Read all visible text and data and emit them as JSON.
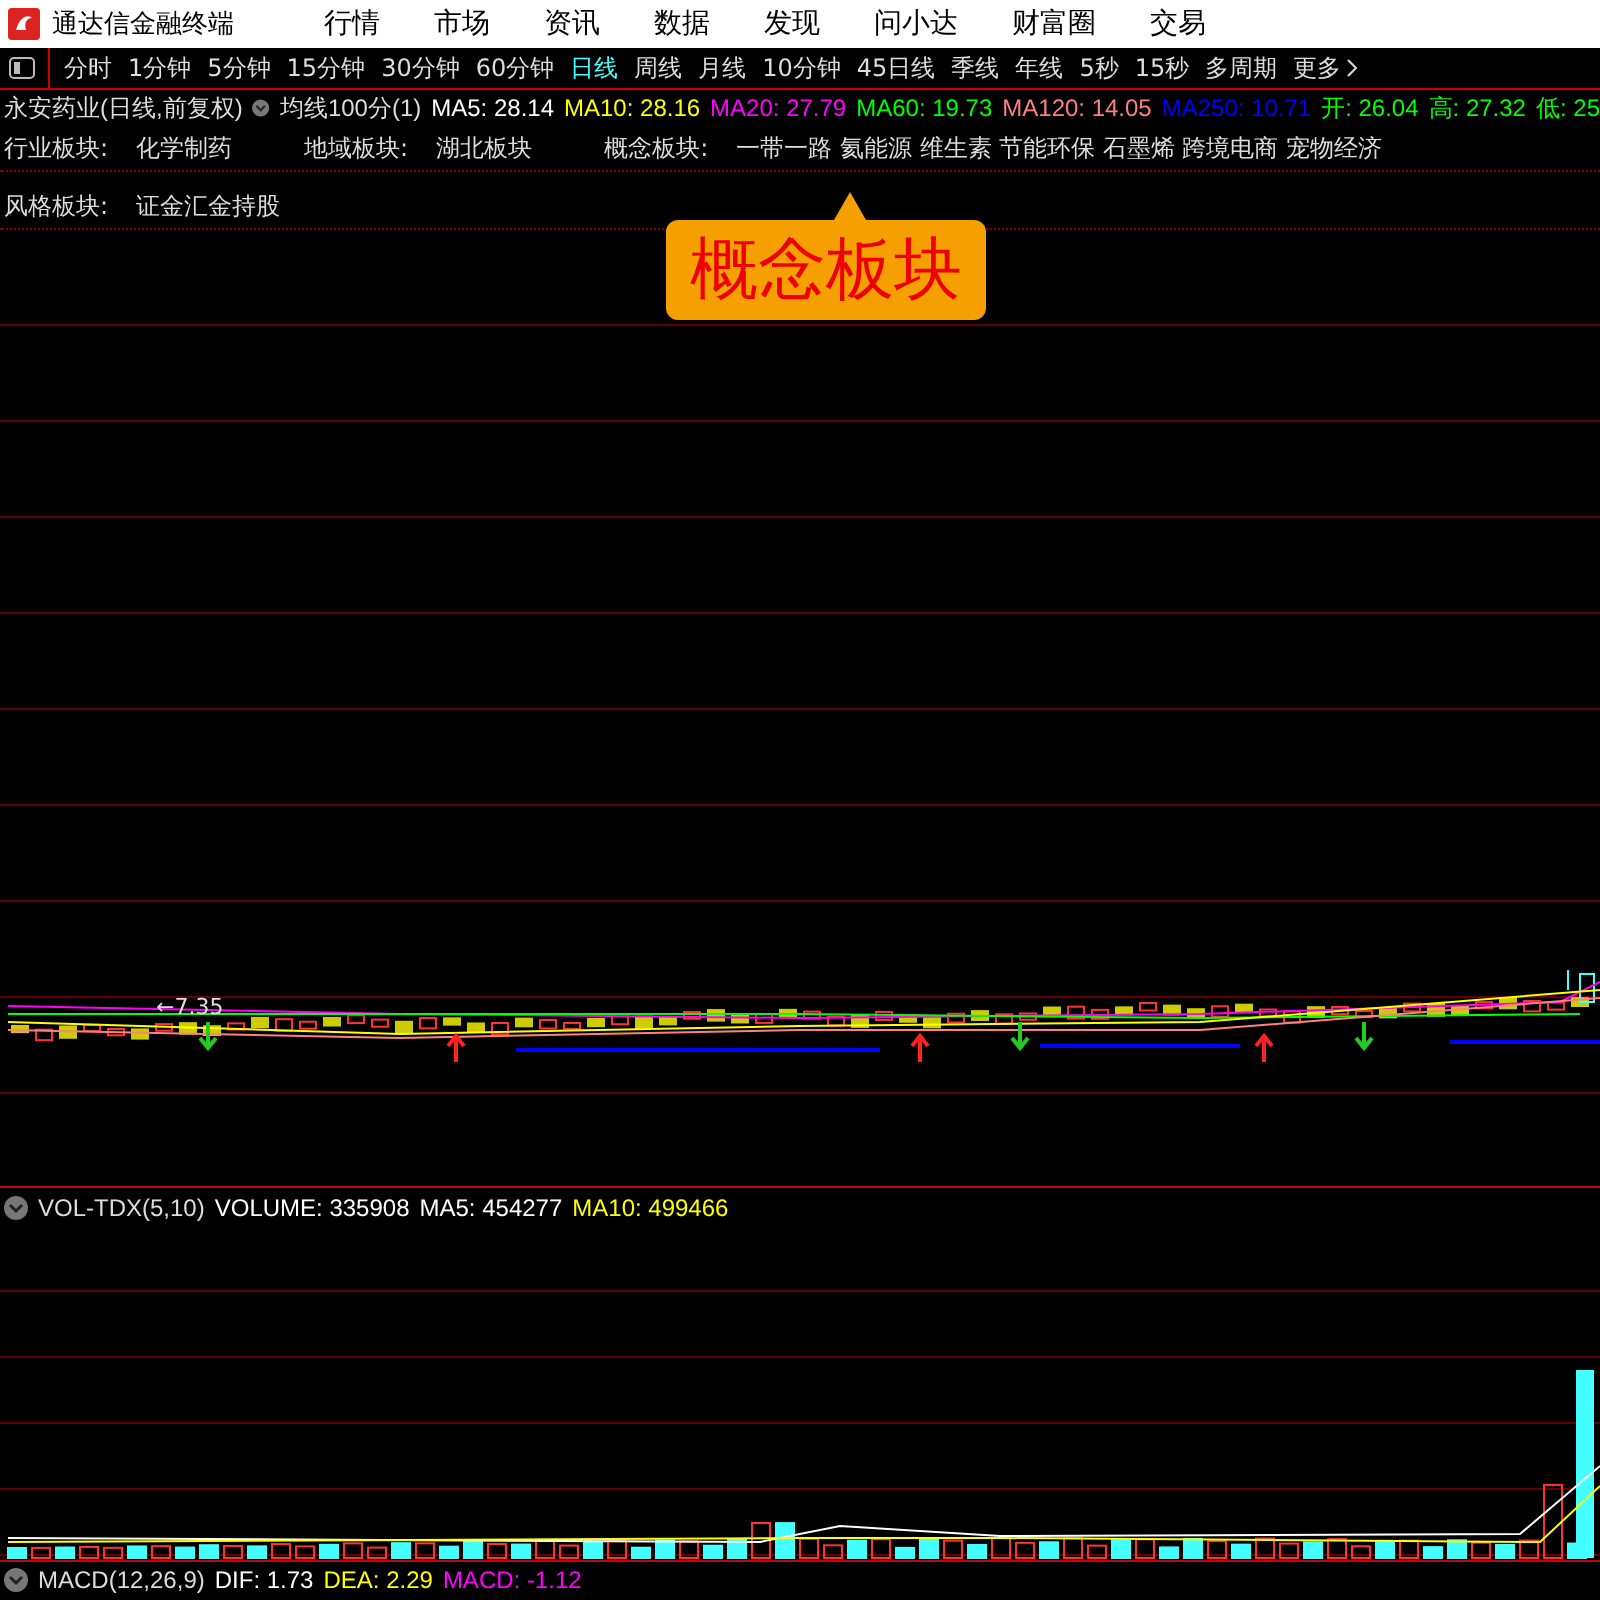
{
  "app": {
    "title": "通达信金融终端"
  },
  "menu": [
    "行情",
    "市场",
    "资讯",
    "数据",
    "发现",
    "问小达",
    "财富圈",
    "交易"
  ],
  "periods": [
    {
      "label": "分时",
      "selected": false
    },
    {
      "label": "1分钟",
      "selected": false
    },
    {
      "label": "5分钟",
      "selected": false
    },
    {
      "label": "15分钟",
      "selected": false
    },
    {
      "label": "30分钟",
      "selected": false
    },
    {
      "label": "60分钟",
      "selected": false
    },
    {
      "label": "日线",
      "selected": true
    },
    {
      "label": "周线",
      "selected": false
    },
    {
      "label": "月线",
      "selected": false
    },
    {
      "label": "10分钟",
      "selected": false
    },
    {
      "label": "45日线",
      "selected": false
    },
    {
      "label": "季线",
      "selected": false
    },
    {
      "label": "年线",
      "selected": false
    },
    {
      "label": "5秒",
      "selected": false
    },
    {
      "label": "15秒",
      "selected": false
    },
    {
      "label": "多周期",
      "selected": false
    },
    {
      "label": "更多",
      "selected": false
    }
  ],
  "stock": {
    "name": "永安药业(日线,前复权)",
    "average": "均线100分(1)",
    "indicators": [
      {
        "text": "MA5: 28.14",
        "color": "#ffffff"
      },
      {
        "text": "MA10: 28.16",
        "color": "#ffff00"
      },
      {
        "text": "MA20: 27.79",
        "color": "#ff00ff"
      },
      {
        "text": "MA60: 19.73",
        "color": "#00ff00"
      },
      {
        "text": "MA120: 14.05",
        "color": "#ff8080"
      },
      {
        "text": "MA250: 10.71",
        "color": "#0000ff"
      },
      {
        "text": "开: 26.04",
        "color": "#00ff00"
      },
      {
        "text": "高: 27.32",
        "color": "#00ff00"
      },
      {
        "text": "低: 25",
        "color": "#00ff00"
      }
    ]
  },
  "sectors": [
    [
      {
        "label": "行业板块:",
        "value": "化学制药"
      },
      {
        "label": "地域板块:",
        "value": "湖北板块"
      },
      {
        "label": "概念板块:",
        "value": "一带一路 氦能源 维生素 节能环保 石墨烯 跨境电商 宠物经济"
      }
    ],
    [
      {
        "label": "风格板块:",
        "value": "证金汇金持股"
      }
    ]
  ],
  "callout": "概念板块",
  "price_chart": {
    "low_label": "←7.35"
  },
  "volume": {
    "name": "VOL-TDX(5,10)",
    "indicators": [
      {
        "text": "VOLUME: 335908",
        "color": "#ffffff"
      },
      {
        "text": "MA5: 454277",
        "color": "#ffffff"
      },
      {
        "text": "MA10: 499466",
        "color": "#ffff00"
      }
    ]
  },
  "macd": {
    "name": "MACD(12,26,9)",
    "indicators": [
      {
        "text": "DIF: 1.73",
        "color": "#ffffff"
      },
      {
        "text": "DEA: 2.29",
        "color": "#ffff00"
      },
      {
        "text": "MACD: -1.12",
        "color": "#ff00ff"
      }
    ]
  }
}
